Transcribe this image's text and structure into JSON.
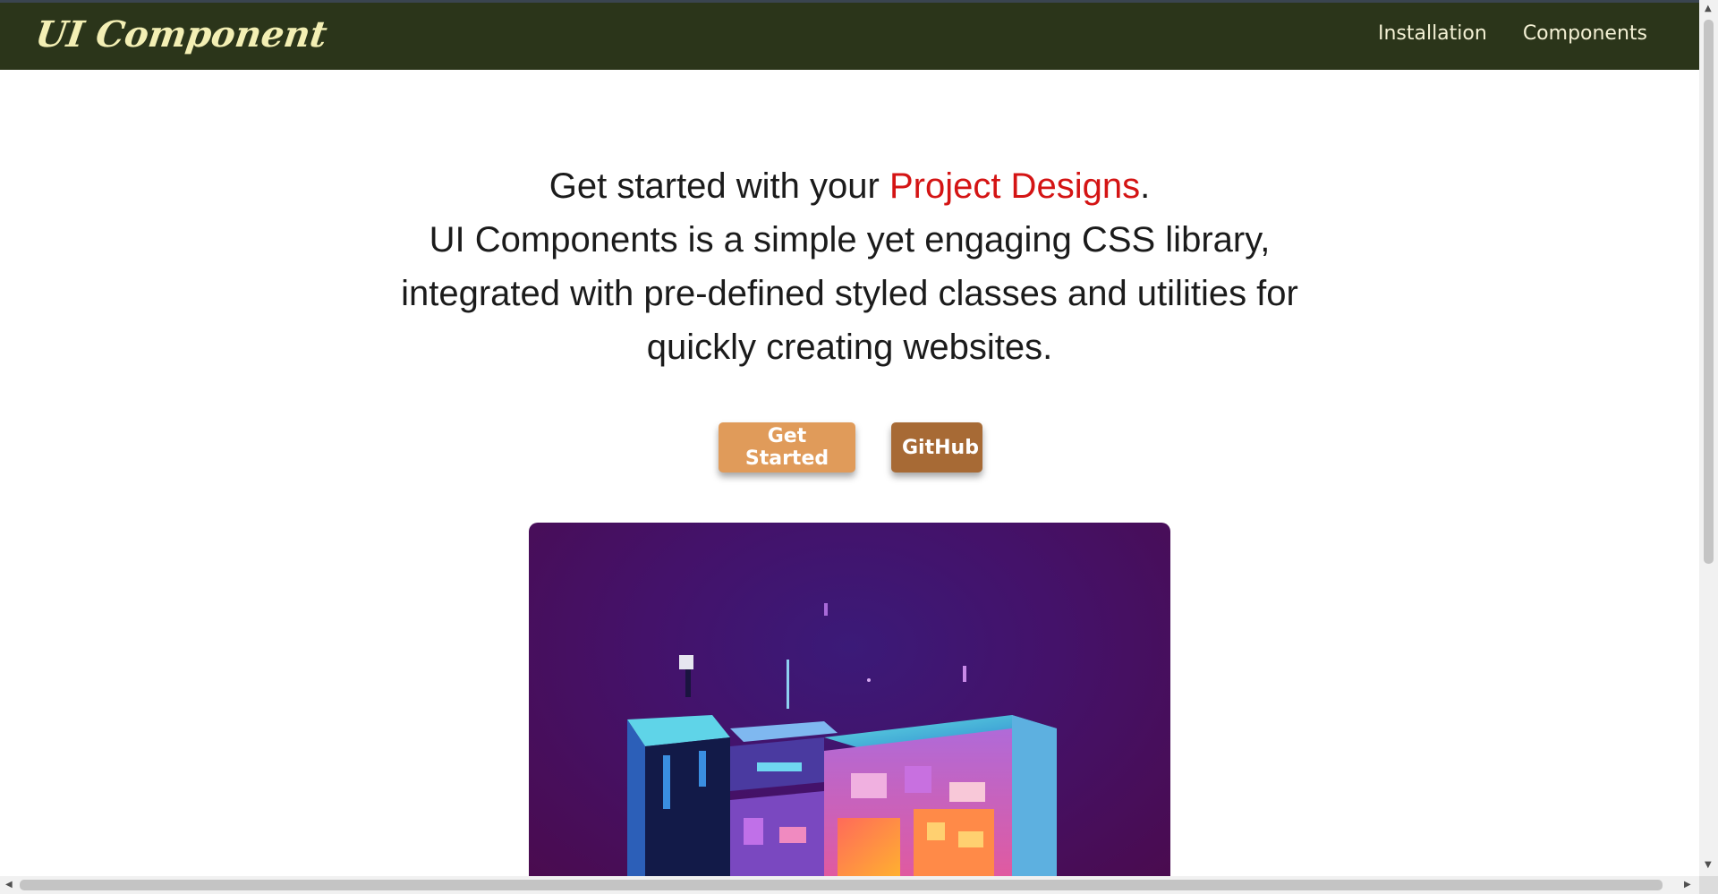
{
  "navbar": {
    "brand": "UI Component",
    "links": [
      "Installation",
      "Components"
    ],
    "background": "#2b351a",
    "brand_color": "#f3efb4"
  },
  "hero": {
    "line1_prefix": "Get started with your ",
    "line1_accent": "Project Designs",
    "line1_suffix": ".",
    "body": "UI Components is a simple yet engaging CSS library, integrated with pre-defined styled classes and utilities for quickly creating websites.",
    "accent_color": "#d41414"
  },
  "buttons": {
    "primary_label": "Get Started",
    "secondary_label": "GitHub",
    "primary_color": "#e09b5a",
    "secondary_color": "#a76a35"
  },
  "image": {
    "icon": "isometric-city-illustration"
  },
  "scrollbars": {
    "up_icon": "chevron-up-icon",
    "down_icon": "chevron-down-icon",
    "left_icon": "chevron-left-icon",
    "right_icon": "chevron-right-icon"
  }
}
